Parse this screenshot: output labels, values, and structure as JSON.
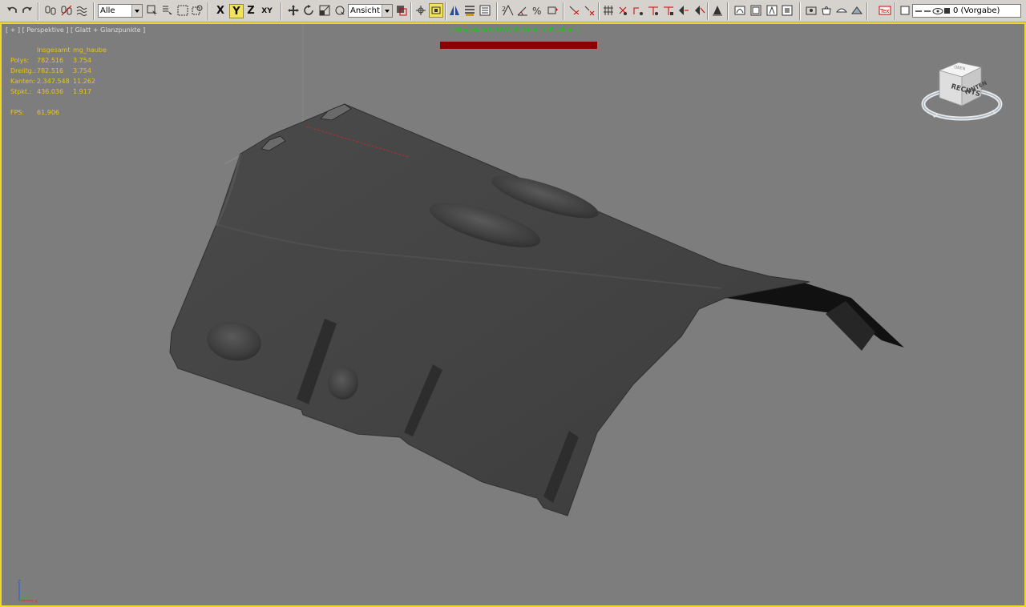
{
  "toolbar": {
    "selection_filter": "Alle",
    "axis_x": "X",
    "axis_y": "Y",
    "axis_z": "Z",
    "axis_xy": "XY",
    "ref_coord": "Ansicht",
    "layer": "0 (Vorgabe)",
    "active_axis": "Y"
  },
  "viewport": {
    "label": "[ + ] [ Perspektive ] [ Glatt + Glanzpunkte ]",
    "warning": "[ Umgekehrte UVW-Flächen: 0 Flächen ]",
    "stats": {
      "header_total": "Insgesamt",
      "header_object": "mg_haube",
      "rows": [
        {
          "label": "Polys:",
          "total": "782.516",
          "object": "3.754"
        },
        {
          "label": "Dreiitg.:",
          "total": "782.516",
          "object": "3.754"
        },
        {
          "label": "Kanten:",
          "total": "2.347.548",
          "object": "11.262"
        },
        {
          "label": "Stpkt.:",
          "total": "436.036",
          "object": "1.917"
        }
      ],
      "fps_label": "FPS:",
      "fps_value": "61,906"
    },
    "viewcube": {
      "top": "OBEN",
      "left": "RECHTS",
      "right": "HINTEN"
    },
    "tripod": {
      "z": "z",
      "x": "x",
      "y": "y"
    }
  },
  "colors": {
    "toolbar_bg": "#d6d3ce",
    "viewport_bg": "#7d7d7d",
    "viewport_border": "#f0d82a",
    "stats_text": "#e8c420",
    "warning_text": "#10d010",
    "warning_bar": "#8c0000",
    "mesh": "#444444"
  }
}
